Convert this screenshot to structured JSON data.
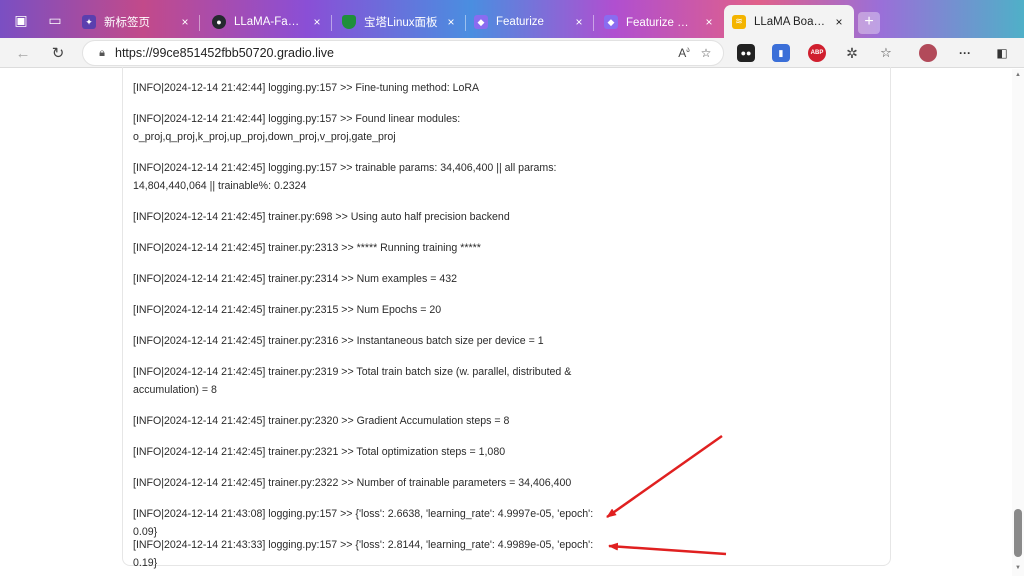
{
  "browser": {
    "tabs": [
      {
        "title": "新标签页",
        "icon": "new-tab-icon"
      },
      {
        "title": "LLaMA-Factory/dat",
        "icon": "github-icon"
      },
      {
        "title": "宝塔Linux面板",
        "icon": "baota-shield-icon"
      },
      {
        "title": "Featurize",
        "icon": "featurize-icon"
      },
      {
        "title": "Featurize 工作区",
        "icon": "featurize-icon"
      },
      {
        "title": "LLaMA Board (feat",
        "icon": "gradio-icon"
      }
    ],
    "new_tab_symbol": "+",
    "close_symbol": "×",
    "url": "https://99ce851452fbb50720.gradio.live",
    "extensions": [
      {
        "name": "tampermonkey-icon",
        "label": ""
      },
      {
        "name": "bookmark-ext-icon",
        "label": ""
      },
      {
        "name": "adblock-plus-icon",
        "label": "ABP"
      },
      {
        "name": "extensions-icon",
        "label": ""
      },
      {
        "name": "favorites-icon",
        "label": ""
      },
      {
        "name": "profile-avatar-icon",
        "label": ""
      },
      {
        "name": "more-icon",
        "label": "···"
      },
      {
        "name": "sidebar-icon",
        "label": ""
      }
    ]
  },
  "log": {
    "lines": [
      [
        "[INFO|2024-12-14 21:42:44] logging.py:157 >> Fine-tuning method: LoRA"
      ],
      [
        "[INFO|2024-12-14 21:42:44] logging.py:157 >> Found linear modules:",
        "o_proj,q_proj,k_proj,up_proj,down_proj,v_proj,gate_proj"
      ],
      [
        "[INFO|2024-12-14 21:42:45] logging.py:157 >> trainable params: 34,406,400 || all params:",
        "14,804,440,064 || trainable%: 0.2324"
      ],
      [
        "[INFO|2024-12-14 21:42:45] trainer.py:698 >> Using auto half precision backend"
      ],
      [
        "[INFO|2024-12-14 21:42:45] trainer.py:2313 >> ***** Running training *****"
      ],
      [
        "[INFO|2024-12-14 21:42:45] trainer.py:2314 >> Num examples = 432"
      ],
      [
        "[INFO|2024-12-14 21:42:45] trainer.py:2315 >> Num Epochs = 20"
      ],
      [
        "[INFO|2024-12-14 21:42:45] trainer.py:2316 >> Instantaneous batch size per device = 1"
      ],
      [
        "[INFO|2024-12-14 21:42:45] trainer.py:2319 >> Total train batch size (w. parallel, distributed &",
        "accumulation) = 8"
      ],
      [
        "[INFO|2024-12-14 21:42:45] trainer.py:2320 >> Gradient Accumulation steps = 8"
      ],
      [
        "[INFO|2024-12-14 21:42:45] trainer.py:2321 >> Total optimization steps = 1,080"
      ],
      [
        "[INFO|2024-12-14 21:42:45] trainer.py:2322 >> Number of trainable parameters = 34,406,400"
      ],
      [
        "[INFO|2024-12-14 21:43:08] logging.py:157 >> {'loss': 2.6638, 'learning_rate': 4.9997e-05, 'epoch': 0.09}"
      ],
      [
        "[INFO|2024-12-14 21:43:33] logging.py:157 >> {'loss': 2.8144, 'learning_rate': 4.9989e-05, 'epoch': 0.19}"
      ]
    ]
  },
  "annotations": {
    "arrow_color": "#e02020"
  }
}
